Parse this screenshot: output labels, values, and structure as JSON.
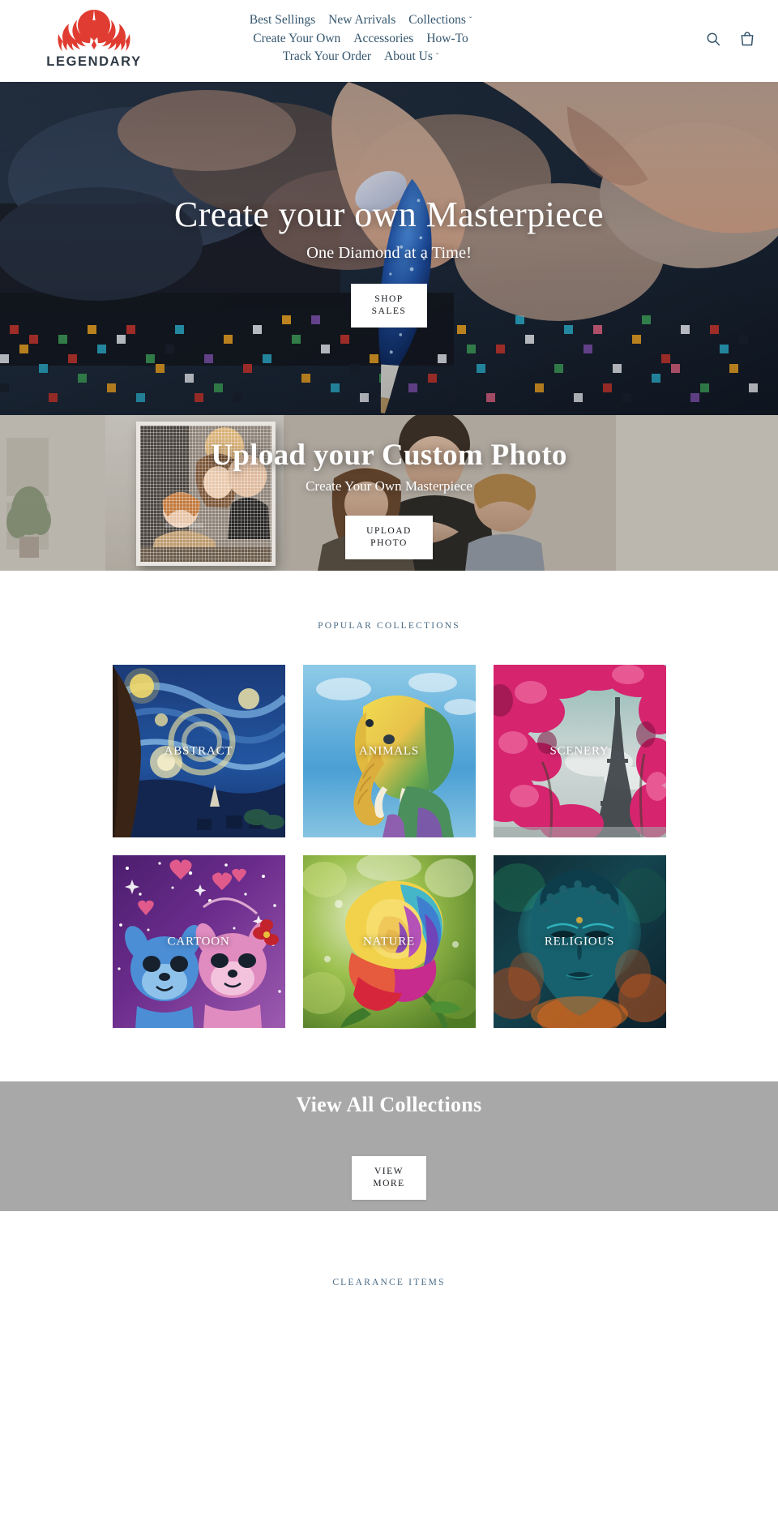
{
  "brand": {
    "name": "LEGENDARY",
    "logo_icon": "phoenix-flame-icon",
    "logo_color": "#e03c31",
    "wordmark_color": "#2f3a45"
  },
  "header": {
    "nav_color": "#34566e",
    "nav_rows": [
      [
        {
          "label": "Best Sellings",
          "dropdown": false
        },
        {
          "label": "New Arrivals",
          "dropdown": false
        },
        {
          "label": "Collections",
          "dropdown": true
        }
      ],
      [
        {
          "label": "Create Your Own",
          "dropdown": false
        },
        {
          "label": "Accessories",
          "dropdown": false
        },
        {
          "label": "How-To",
          "dropdown": false
        }
      ],
      [
        {
          "label": "Track Your Order",
          "dropdown": false
        },
        {
          "label": "About Us",
          "dropdown": true
        }
      ]
    ],
    "caret_glyph": "ˇ",
    "icons": [
      {
        "name": "search-icon",
        "label": "Search"
      },
      {
        "name": "cart-icon",
        "label": "Cart"
      }
    ]
  },
  "hero": {
    "title": "Create your own Masterpiece",
    "subtitle": "One Diamond at a Time!",
    "button_line1": "SHOP",
    "button_line2": "SALES",
    "image_description": "diamond-painting-with-applicator-pen"
  },
  "upload_banner": {
    "title": "Upload your Custom Photo",
    "subtitle": "Create Your Own Masterpiece",
    "button_line1": "UPLOAD",
    "button_line2": "PHOTO",
    "image_description": "family-photo-with-framed-diamond-canvas"
  },
  "collections": {
    "eyebrow": "POPULAR COLLECTIONS",
    "tiles": [
      {
        "label": "ABSTRACT",
        "art": "starry-night"
      },
      {
        "label": "ANIMALS",
        "art": "watercolor-elephant"
      },
      {
        "label": "SCENERY",
        "art": "eiffel-tower-blossoms"
      },
      {
        "label": "CARTOON",
        "art": "stitch-and-angel"
      },
      {
        "label": "NATURE",
        "art": "rainbow-rose"
      },
      {
        "label": "RELIGIOUS",
        "art": "buddha-face"
      }
    ]
  },
  "view_all": {
    "title": "View All Collections",
    "button_line1": "VIEW",
    "button_line2": "MORE",
    "band_color": "#a8a8a8"
  },
  "clearance": {
    "eyebrow": "CLEARANCE ITEMS"
  }
}
